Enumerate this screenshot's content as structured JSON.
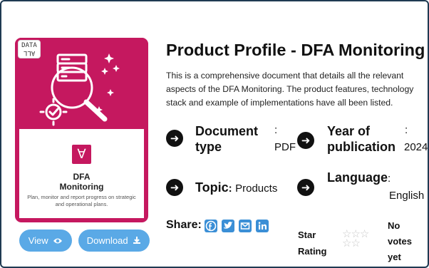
{
  "product": {
    "title": "Product Profile - DFA Monitoring",
    "description": "This is a comprehensive document that details all the relevant aspects of the DFA Monitoring. The product features, technology stack and example of implementations have all been listed."
  },
  "card": {
    "logo_text_line1": "DATA",
    "logo_text_line2": "ALL",
    "badge_glyph": "∀",
    "title_line1": "DFA",
    "title_line2": "Monitoring",
    "subtitle": "Plan, monitor and report progress on strategic and operational plans.",
    "accent_color": "#c5185f"
  },
  "buttons": {
    "view_label": "View",
    "view_icon": "eye-icon",
    "download_label": "Download",
    "download_icon": "download-icon",
    "color": "#5aa9e6"
  },
  "meta": {
    "doc_type_label_1": "Document",
    "doc_type_label_2": "type",
    "doc_type_value": "PDF",
    "year_label_1": "Year of",
    "year_label_2": "publication",
    "year_value": "2024",
    "topic_label": "Topic",
    "topic_value": "Products",
    "language_label": "Language",
    "language_value": "English",
    "colon": ":"
  },
  "share": {
    "label": "Share:",
    "icons": [
      "facebook-icon",
      "twitter-icon",
      "email-icon",
      "linkedin-icon"
    ]
  },
  "rating": {
    "label_1": "Star",
    "label_2": "Rating",
    "stars_filled": 0,
    "stars_total": 5,
    "votes_1": "No",
    "votes_2": "votes",
    "votes_3": "yet"
  }
}
